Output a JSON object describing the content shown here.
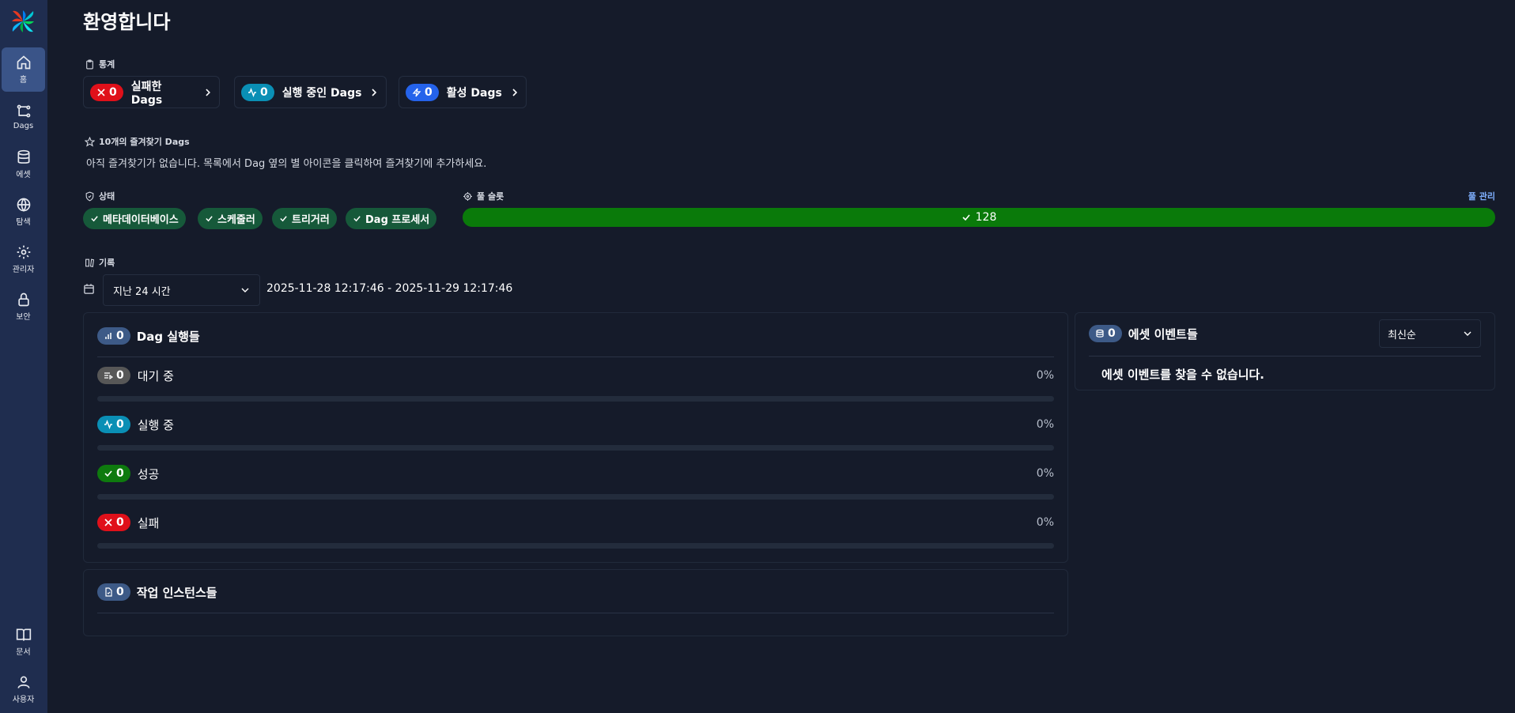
{
  "sidebar": {
    "items": [
      {
        "label": "홈",
        "icon": "home-icon"
      },
      {
        "label": "Dags",
        "icon": "dag-icon"
      },
      {
        "label": "에셋",
        "icon": "database-icon"
      },
      {
        "label": "탐색",
        "icon": "globe-icon"
      },
      {
        "label": "관리자",
        "icon": "gear-icon"
      },
      {
        "label": "보안",
        "icon": "lock-icon"
      },
      {
        "label": "문서",
        "icon": "book-icon"
      },
      {
        "label": "사용자",
        "icon": "user-icon"
      }
    ]
  },
  "page": {
    "title": "환영합니다"
  },
  "stats": {
    "label": "통계",
    "cards": [
      {
        "count": "0",
        "label": "실패한 Dags"
      },
      {
        "count": "0",
        "label": "실행 중인 Dags"
      },
      {
        "count": "0",
        "label": "활성 Dags"
      }
    ]
  },
  "favorites": {
    "label": "10개의 즐겨찾기 Dags",
    "empty": "아직 즐겨찾기가 없습니다. 목록에서 Dag 옆의 별 아이콘을 클릭하여 즐겨찾기에 추가하세요."
  },
  "health": {
    "label": "상태",
    "items": [
      "메타데이터베이스",
      "스케줄러",
      "트리거러",
      "Dag 프로세서"
    ]
  },
  "pool": {
    "label": "풀 슬롯",
    "manage": "풀 관리",
    "slots": "128"
  },
  "history": {
    "label": "기록",
    "range_select": "지난 24 시간",
    "range_text": "2025-11-28 12:17:46 - 2025-11-29 12:17:46"
  },
  "dag_runs": {
    "count": "0",
    "title": "Dag 실행들",
    "rows": [
      {
        "count": "0",
        "label": "대기 중",
        "pct": "0%",
        "fraction": 0
      },
      {
        "count": "0",
        "label": "실행 중",
        "pct": "0%",
        "fraction": 0
      },
      {
        "count": "0",
        "label": "성공",
        "pct": "0%",
        "fraction": 0
      },
      {
        "count": "0",
        "label": "실패",
        "pct": "0%",
        "fraction": 0
      }
    ]
  },
  "task_instances": {
    "count": "0",
    "title": "작업 인스턴스들"
  },
  "asset_events": {
    "count": "0",
    "title": "에셋 이벤트들",
    "sort": "최신순",
    "empty": "에셋 이벤트를 찾을 수 없습니다."
  },
  "colors": {
    "failed": "#e0101a",
    "running": "#0a8fb5",
    "active": "#2563eb",
    "queued": "#575757",
    "success": "#0e7a0e",
    "accent": "#3d5a87"
  }
}
